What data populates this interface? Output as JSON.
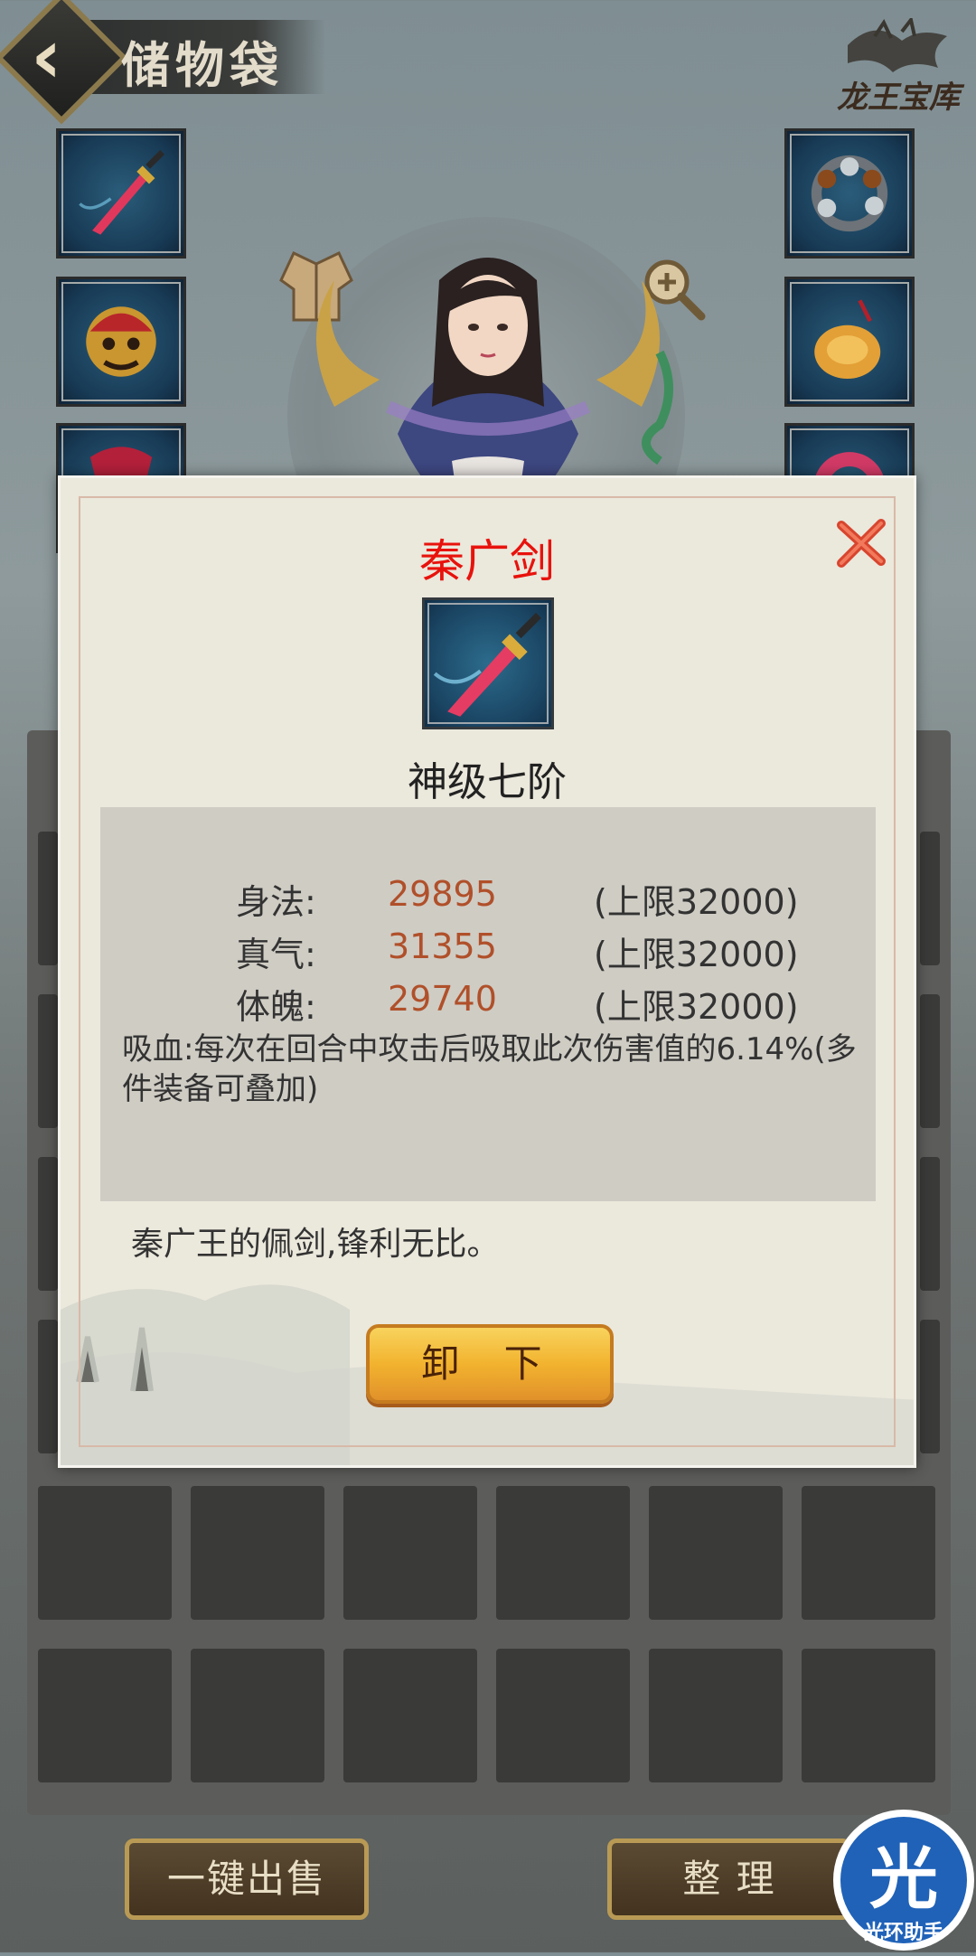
{
  "header": {
    "title": "储物袋",
    "vault_label": "龙王宝库",
    "back_icon": "chevron-left-icon"
  },
  "bag": {
    "sell_all_label": "一键出售",
    "sort_label": "整 理"
  },
  "watermark": {
    "badge_glyph": "光",
    "badge_label": "光环助手"
  },
  "item_popup": {
    "name": "秦广剑",
    "grade": "神级七阶",
    "stats": [
      {
        "label": "身法:",
        "value": "29895",
        "cap": "(上限32000)"
      },
      {
        "label": "真气:",
        "value": "31355",
        "cap": "(上限32000)"
      },
      {
        "label": "体魄:",
        "value": "29740",
        "cap": "(上限32000)"
      }
    ],
    "effect": "吸血:每次在回合中攻击后吸取此次伤害值的6.14%(多件装备可叠加)",
    "description": "秦广王的佩剑,锋利无比。",
    "unequip_label": "卸 下",
    "close_icon": "close-icon"
  },
  "colors": {
    "item_name": "#e8120c",
    "stat_value": "#b0502a",
    "button_gold": "#f2b32f"
  }
}
